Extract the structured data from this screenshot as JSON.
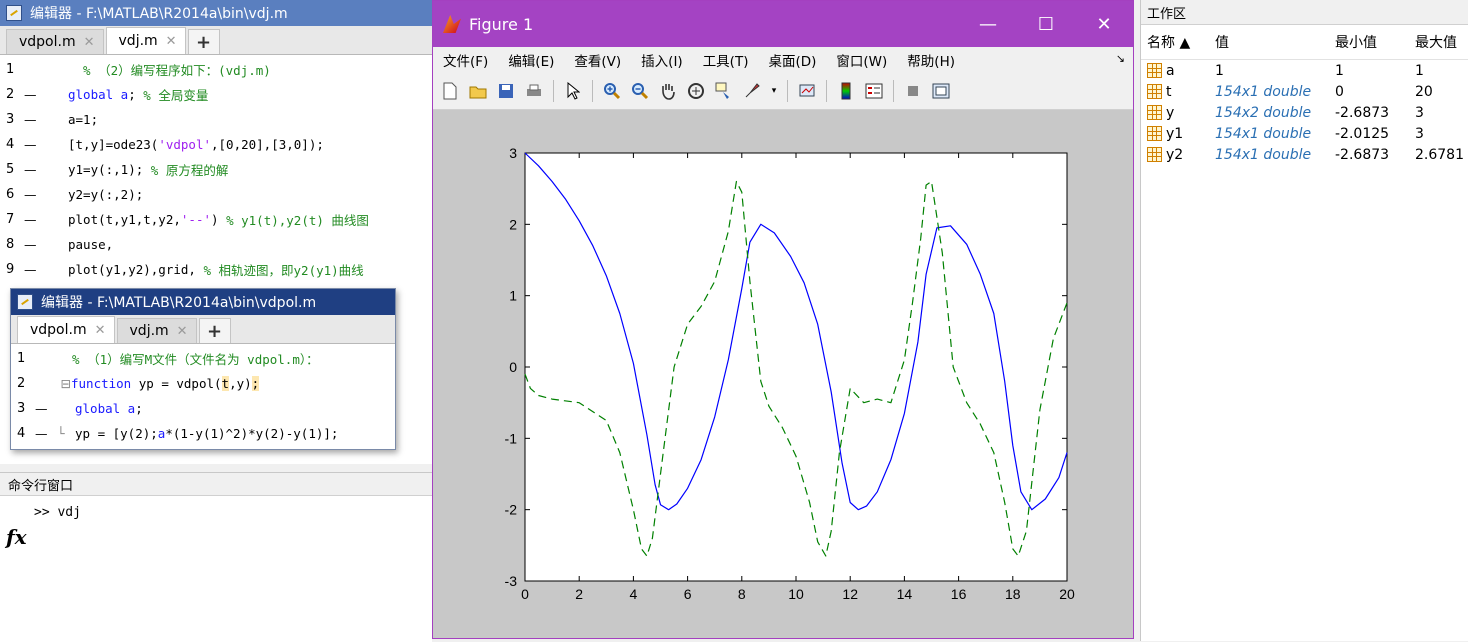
{
  "editor1": {
    "title": "编辑器 - F:\\MATLAB\\R2014a\\bin\\vdj.m",
    "tabs": [
      {
        "label": "vdpol.m"
      },
      {
        "label": "vdj.m"
      }
    ],
    "close_glyph": "✕",
    "add_tab": "+",
    "lines": [
      {
        "num": "1",
        "dash": "",
        "code": "  % （2）编写程序如下：(vdj.m)"
      },
      {
        "num": "2",
        "dash": "—",
        "kw": "global a",
        "rest": "; ",
        "cm": "% 全局变量"
      },
      {
        "num": "3",
        "dash": "—",
        "code": "a=1;"
      },
      {
        "num": "4",
        "dash": "—",
        "pre": "[t,y]=ode23(",
        "str": "'vdpol'",
        "post": ",[0,20],[3,0]);"
      },
      {
        "num": "5",
        "dash": "—",
        "pre": "y1=y(:,1); ",
        "cm": "% 原方程的解"
      },
      {
        "num": "6",
        "dash": "—",
        "code": "y2=y(:,2);"
      },
      {
        "num": "7",
        "dash": "—",
        "pre": "plot(t,y1,t,y2,",
        "str": "'--'",
        "post": ") ",
        "cm": "% y1(t),y2(t) 曲线图"
      },
      {
        "num": "8",
        "dash": "—",
        "code": "pause,"
      },
      {
        "num": "9",
        "dash": "—",
        "pre": "plot(y1,y2),grid, ",
        "cm": "% 相轨迹图，即y2(y1)曲线"
      }
    ]
  },
  "editor2": {
    "title": "编辑器 - F:\\MATLAB\\R2014a\\bin\\vdpol.m",
    "tabs": [
      {
        "label": "vdpol.m"
      },
      {
        "label": "vdj.m"
      }
    ],
    "lines": [
      {
        "num": "1",
        "dash": "",
        "cm": "  % （1）编写M文件（文件名为 vdpol.m）："
      },
      {
        "num": "2",
        "dash": "",
        "fold": "⊟",
        "kw": "function",
        "pre": " yp = vdpol(",
        "hl": "t",
        "post": ",y)",
        "hl2": ";"
      },
      {
        "num": "3",
        "dash": "—",
        "kw": "global a",
        "post": ";"
      },
      {
        "num": "4",
        "dash": "—",
        "fold": "└",
        "pre": "yp = [y(2);",
        "ka": "a",
        "post": "*(1-y(1)^2)*y(2)-y(1)];"
      }
    ]
  },
  "command": {
    "title": "命令行窗口",
    "fx": "fx",
    "prompt": ">> vdj"
  },
  "figure": {
    "title": "Figure 1",
    "win_buttons": [
      "—",
      "☐",
      "✕"
    ],
    "menu": [
      "文件(F)",
      "编辑(E)",
      "查看(V)",
      "插入(I)",
      "工具(T)",
      "桌面(D)",
      "窗口(W)",
      "帮助(H)"
    ],
    "menu_arrow": "↘",
    "colors": {
      "series1": "#0000ff",
      "series2": "#008000"
    }
  },
  "chart_data": {
    "type": "line",
    "title": "",
    "xlabel": "",
    "ylabel": "",
    "xlim": [
      0,
      20
    ],
    "ylim": [
      -3,
      3
    ],
    "xticks": [
      0,
      2,
      4,
      6,
      8,
      10,
      12,
      14,
      16,
      18,
      20
    ],
    "yticks": [
      -3,
      -2,
      -1,
      0,
      1,
      2,
      3
    ],
    "grid": false,
    "series": [
      {
        "style": "solid",
        "color": "#0000ff",
        "x": [
          0,
          0.5,
          1,
          1.5,
          2,
          2.5,
          3,
          3.5,
          4,
          4.5,
          4.8,
          5,
          5.3,
          5.6,
          6,
          6.5,
          7,
          7.5,
          8,
          8.3,
          8.7,
          9.2,
          9.8,
          10.3,
          10.8,
          11.3,
          11.7,
          12,
          12.3,
          12.6,
          13,
          13.5,
          14,
          14.5,
          14.8,
          15.2,
          15.7,
          16.3,
          16.8,
          17.3,
          17.7,
          18,
          18.3,
          18.7,
          19.2,
          19.7,
          20
        ],
        "y": [
          3,
          2.82,
          2.6,
          2.35,
          2.05,
          1.7,
          1.28,
          0.75,
          0.05,
          -0.95,
          -1.65,
          -1.93,
          -2.0,
          -1.92,
          -1.7,
          -1.3,
          -0.7,
          0.1,
          1.1,
          1.75,
          2.0,
          1.88,
          1.55,
          1.18,
          0.6,
          -0.35,
          -1.35,
          -1.9,
          -2.0,
          -1.95,
          -1.75,
          -1.3,
          -0.65,
          0.35,
          1.3,
          1.95,
          1.98,
          1.72,
          1.3,
          0.75,
          -0.2,
          -1.1,
          -1.75,
          -2.0,
          -1.85,
          -1.55,
          -1.2
        ]
      },
      {
        "style": "dashed",
        "color": "#008000",
        "x": [
          0,
          0.2,
          0.5,
          1,
          2,
          3,
          3.5,
          4,
          4.3,
          4.5,
          4.7,
          5,
          5.5,
          6,
          6.5,
          7,
          7.5,
          7.8,
          8,
          8.3,
          8.7,
          9,
          9.5,
          10,
          10.5,
          10.8,
          11.1,
          11.3,
          11.6,
          12,
          12.5,
          13,
          13.5,
          14,
          14.3,
          14.6,
          14.8,
          15,
          15.4,
          15.8,
          16.3,
          16.8,
          17.3,
          17.7,
          18,
          18.2,
          18.5,
          19,
          19.5,
          20
        ],
        "y": [
          -0.1,
          -0.3,
          -0.4,
          -0.45,
          -0.5,
          -0.75,
          -1.2,
          -2.0,
          -2.55,
          -2.65,
          -2.4,
          -1.5,
          0.0,
          0.6,
          0.85,
          1.2,
          1.9,
          2.6,
          2.45,
          1.2,
          -0.2,
          -0.55,
          -0.85,
          -1.25,
          -1.9,
          -2.45,
          -2.65,
          -2.3,
          -1.2,
          -0.3,
          -0.5,
          -0.45,
          -0.5,
          0.1,
          0.9,
          1.8,
          2.55,
          2.6,
          1.6,
          0.0,
          -0.5,
          -0.8,
          -1.2,
          -1.9,
          -2.55,
          -2.65,
          -2.3,
          -0.6,
          0.4,
          0.9
        ]
      }
    ]
  },
  "workspace": {
    "title": "工作区",
    "columns": [
      "名称 ▲",
      "值",
      "最小值",
      "最大值"
    ],
    "rows": [
      {
        "name": "a",
        "value": "1",
        "min": "1",
        "max": "1",
        "italic": false
      },
      {
        "name": "t",
        "value": "154x1 double",
        "min": "0",
        "max": "20",
        "italic": true
      },
      {
        "name": "y",
        "value": "154x2 double",
        "min": "-2.6873",
        "max": "3",
        "italic": true
      },
      {
        "name": "y1",
        "value": "154x1 double",
        "min": "-2.0125",
        "max": "3",
        "italic": true
      },
      {
        "name": "y2",
        "value": "154x1 double",
        "min": "-2.6873",
        "max": "2.6781",
        "italic": true
      }
    ]
  }
}
